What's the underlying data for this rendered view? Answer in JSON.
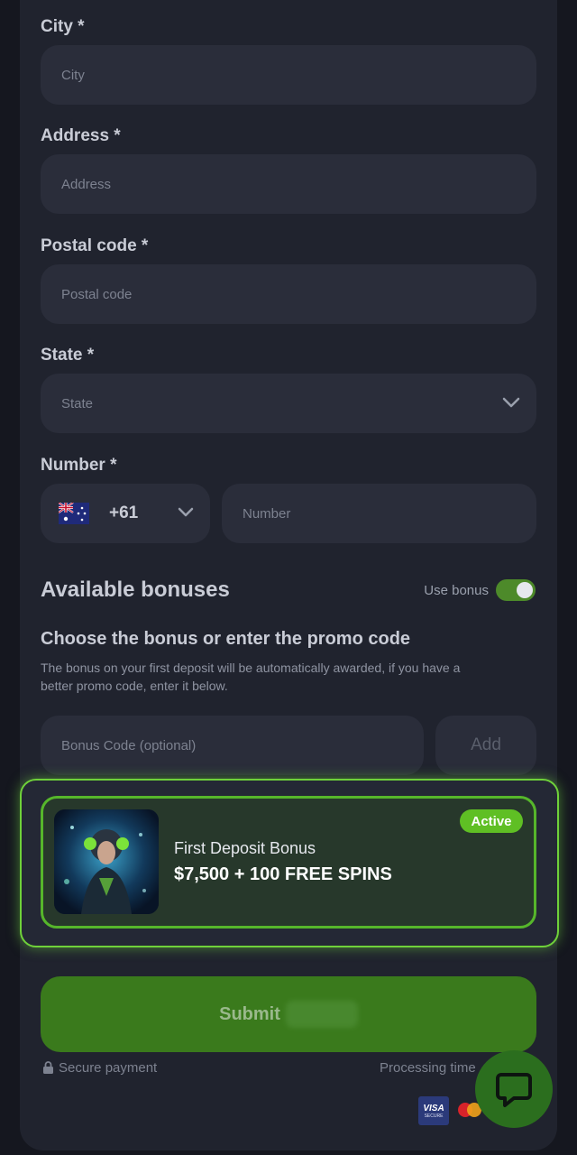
{
  "form": {
    "city": {
      "label": "City *",
      "placeholder": "City"
    },
    "address": {
      "label": "Address *",
      "placeholder": "Address"
    },
    "postal": {
      "label": "Postal code *",
      "placeholder": "Postal code"
    },
    "state": {
      "label": "State *",
      "placeholder": "State"
    },
    "number": {
      "label": "Number *",
      "country_code": "+61",
      "placeholder": "Number",
      "flag_icon": "australia-flag-icon"
    }
  },
  "bonuses": {
    "heading": "Available bonuses",
    "toggle_label": "Use bonus",
    "toggle_on": true,
    "subheading": "Choose the bonus or enter the promo code",
    "description_line1": "The bonus on your first deposit will be automatically awarded, if you have a",
    "description_line2": "better promo code, enter it below.",
    "code_placeholder": "Bonus Code (optional)",
    "add_label": "Add",
    "card": {
      "badge": "Active",
      "title": "First Deposit Bonus",
      "offer": "$7,500 + 100 FREE SPINS"
    }
  },
  "submit": {
    "label": "Submit"
  },
  "footer": {
    "secure": "Secure payment",
    "processing": "Processing time",
    "visa": "VISA",
    "visa_sub": "SECURE"
  },
  "colors": {
    "accent": "#5fbf24",
    "panel": "#20232e",
    "field": "#2a2d3a"
  }
}
